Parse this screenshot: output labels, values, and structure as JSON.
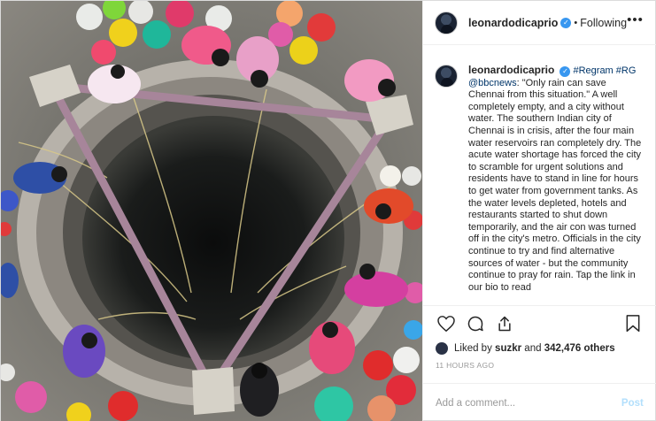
{
  "post": {
    "image_alt": "",
    "author": {
      "username": "leonardodicaprio",
      "verified_icon": "check-icon",
      "separator": "•",
      "follow_label": "Following"
    },
    "more_label": "•••",
    "caption": {
      "username": "leonardodicaprio",
      "tags": "#Regram #RG",
      "mention": "@bbcnews",
      "text": ": \"Only rain can save Chennai from this situation.\" A well completely empty, and a city without water. The southern Indian city of Chennai is in crisis, after the four main water reservoirs ran completely dry. The acute water shortage has forced the city to scramble for urgent solutions and residents have to stand in line for hours to get water from government tanks. As the water levels depleted, hotels and restaurants started to shut down temporarily, and the air con was turned off in the city's metro. Officials in the city continue to try and find alternative sources of water - but the community continue to pray for rain. Tap the link in our bio to read"
    },
    "actions": [
      "heart-icon",
      "comment-icon",
      "share-icon",
      "bookmark-icon"
    ],
    "likes": {
      "prefix": "Liked by",
      "user": "suzkr",
      "joiner": "and",
      "others": "342,476 others"
    },
    "timestamp": "11 HOURS AGO",
    "comment_box": {
      "placeholder": "Add a comment...",
      "post_label": "Post"
    },
    "colors": {
      "link": "#003569",
      "verified": "#3897f0",
      "post_disabled": "#b2dffc"
    }
  }
}
